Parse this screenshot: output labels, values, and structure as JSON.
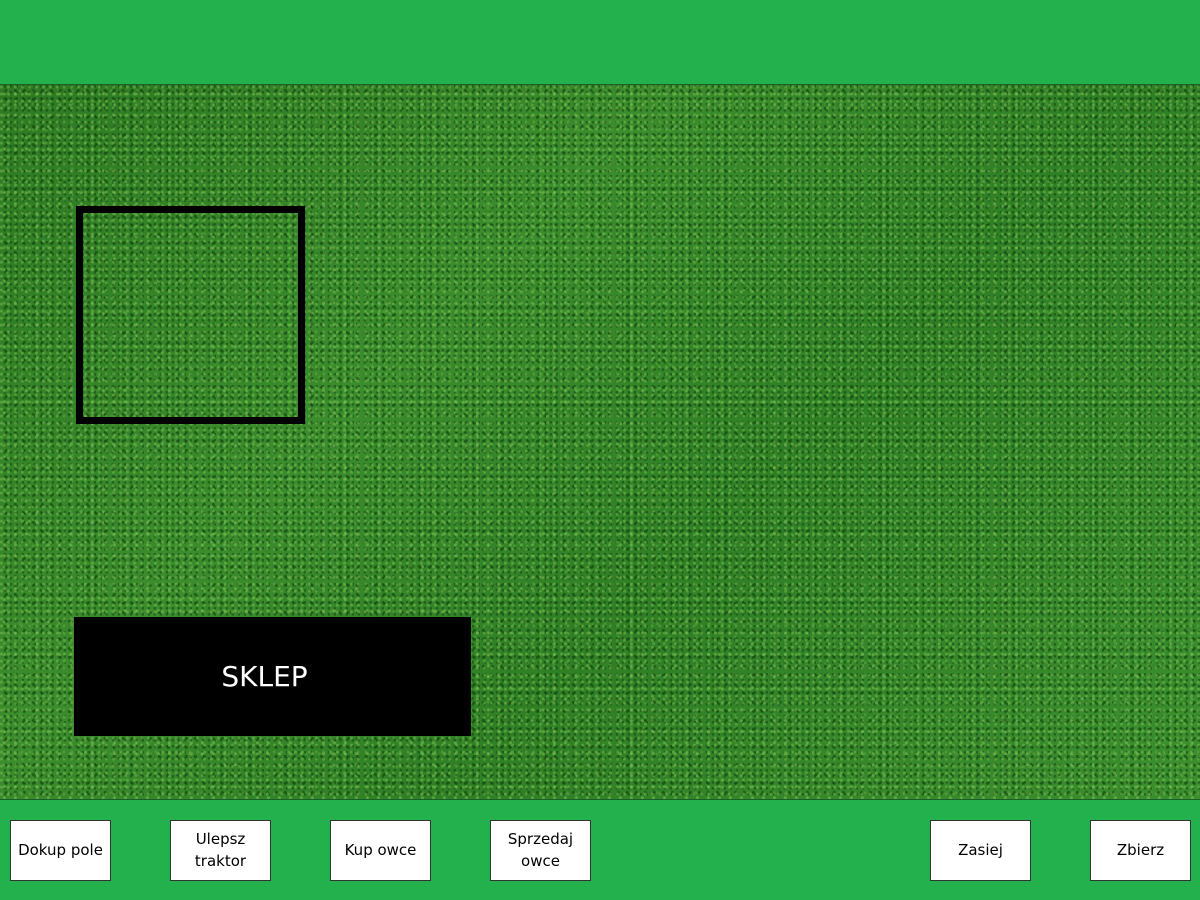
{
  "shop": {
    "label": "SKLEP"
  },
  "actions": [
    {
      "label": "Dokup pole"
    },
    {
      "label": "Ulepsz\ntraktor"
    },
    {
      "label": "Kup owce"
    },
    {
      "label": "Sprzedaj\nowce"
    },
    {
      "label": "Zasiej"
    },
    {
      "label": "Zbierz"
    }
  ],
  "colors": {
    "bar_green": "#22b14c",
    "grass": "#2f7f25",
    "shop_bg": "#000000",
    "shop_text": "#ffffff"
  }
}
